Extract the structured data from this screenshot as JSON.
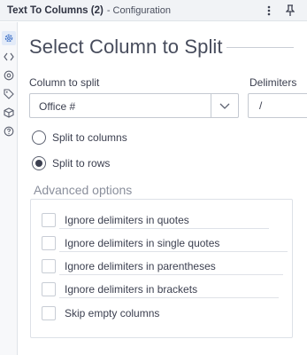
{
  "titlebar": {
    "tool_name": "Text To Columns (2)",
    "subtitle": "- Configuration"
  },
  "rail": {
    "items": [
      {
        "icon": "gear-icon",
        "active": true
      },
      {
        "icon": "code-icon",
        "active": false
      },
      {
        "icon": "target-icon",
        "active": false
      },
      {
        "icon": "tag-icon",
        "active": false
      },
      {
        "icon": "cube-icon",
        "active": false
      },
      {
        "icon": "help-icon",
        "active": false
      }
    ]
  },
  "main": {
    "heading": "Select Column to Split",
    "column_label": "Column to split",
    "column_value": "Office #",
    "delimiters_label": "Delimiters",
    "delimiters_value": "/",
    "split_options": [
      {
        "label": "Split to columns",
        "checked": false
      },
      {
        "label": "Split to rows",
        "checked": true
      }
    ],
    "advanced_title": "Advanced options",
    "advanced_options": [
      {
        "label": "Ignore delimiters in quotes",
        "checked": false
      },
      {
        "label": "Ignore delimiters in single quotes",
        "checked": false
      },
      {
        "label": "Ignore delimiters in parentheses",
        "checked": false
      },
      {
        "label": "Ignore delimiters in brackets",
        "checked": false
      },
      {
        "label": "Skip empty columns",
        "checked": false
      }
    ]
  },
  "colors": {
    "accent": "#3b6fc7",
    "text": "#3c4050",
    "muted": "#8a8f9c"
  }
}
